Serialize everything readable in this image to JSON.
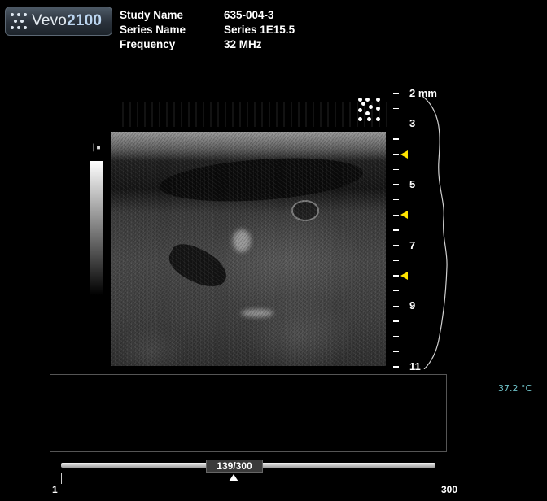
{
  "brand": {
    "name_part": "Vevo",
    "model_part": "2100"
  },
  "study": {
    "rows": [
      {
        "label": "Study Name",
        "value": "635-004-3"
      },
      {
        "label": "Series Name",
        "value": "Series 1E15.5"
      },
      {
        "label": "Frequency",
        "value": "32 MHz"
      }
    ]
  },
  "gray_scale_marker": "|▪",
  "depth_scale": {
    "unit": "mm",
    "first_label": "2 mm",
    "labels": [
      "3",
      "5",
      "7",
      "9",
      "11"
    ],
    "min": 2,
    "max": 11,
    "focus_depths_mm": [
      4,
      6,
      8
    ]
  },
  "temperature": "37.2 °C",
  "frame_slider": {
    "current_label": "139/300",
    "current": 139,
    "min_label": "1",
    "max_label": "300",
    "min": 1,
    "max": 300
  },
  "colors": {
    "focus_marker": "#ffe400",
    "temperature_text": "#6fc2c8",
    "background": "#000000"
  },
  "icons": {
    "logo": "vevo-dots-logo",
    "probe": "transducer-dot-matrix-icon"
  }
}
